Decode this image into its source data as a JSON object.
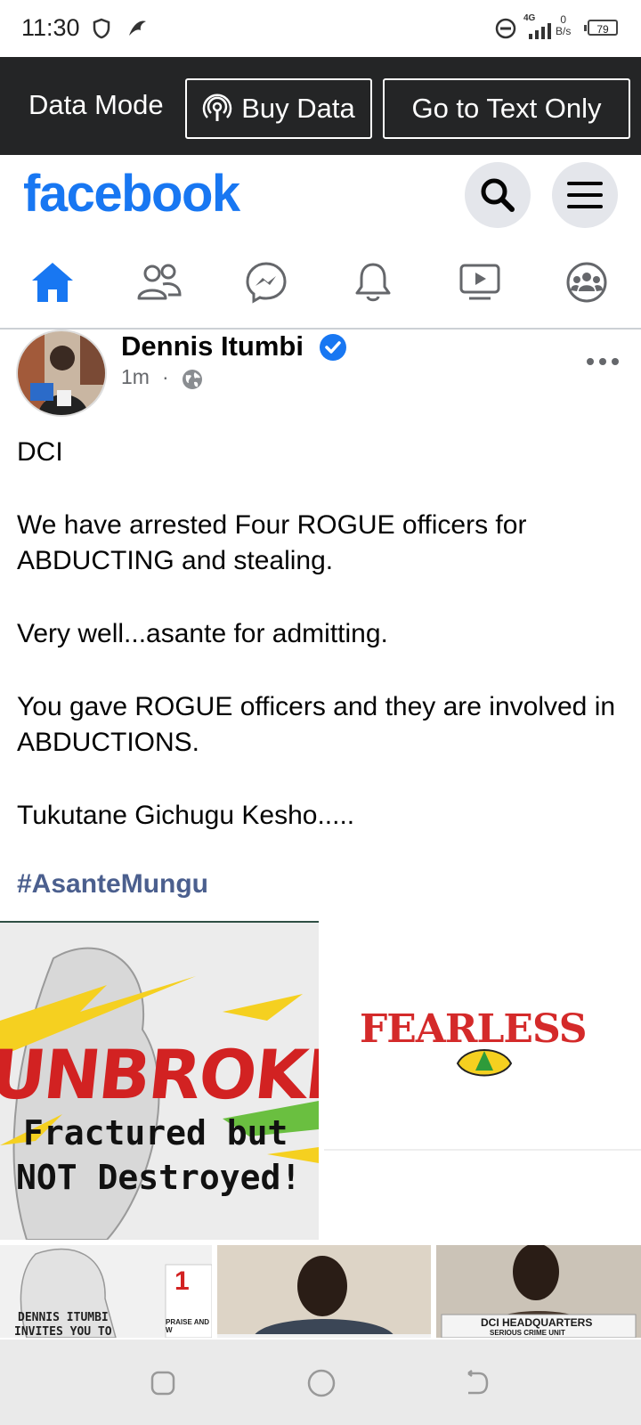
{
  "status_bar": {
    "time": "11:30",
    "network": "4G",
    "speed_value": "0",
    "speed_unit": "B/s",
    "battery": "79"
  },
  "data_bar": {
    "label": "Data Mode",
    "buy_data": "Buy Data",
    "text_only": "Go to Text Only"
  },
  "header": {
    "logo": "facebook"
  },
  "nav_tabs": [
    "home",
    "friends",
    "messenger",
    "notifications",
    "watch",
    "groups"
  ],
  "post": {
    "author": "Dennis Itumbi",
    "time": "1m",
    "dot": "·",
    "paragraphs": [
      "DCI",
      "We have arrested Four ROGUE officers for ABDUCTING and stealing.",
      "Very well...asante for admitting.",
      "You gave ROGUE officers and they are involved in ABDUCTIONS.",
      "Tukutane Gichugu Kesho....."
    ],
    "hashtag": "#AsanteMungu",
    "images": {
      "unbroke_title": "UNBROKE",
      "unbroke_line1": "Fractured but",
      "unbroke_line2": "NOT Destroyed!",
      "fearless": "FEARLESS",
      "invite_line1": "DENNIS ITUMBI",
      "invite_line2": "INVITES YOU TO",
      "praise": "PRAISE AND W",
      "badge_num": "1",
      "dci_line1": "DCI HEADQUARTERS",
      "dci_line2": "SERIOUS CRIME UNIT"
    }
  },
  "colors": {
    "facebook_blue": "#1877f2",
    "dark_bar": "#242526",
    "hashtag": "#4b5f8e",
    "verified": "#1877f2"
  }
}
